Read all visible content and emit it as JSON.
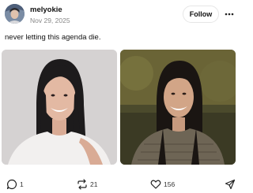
{
  "post": {
    "author": {
      "username": "melyokie",
      "date": "Nov 29, 2025"
    },
    "follow_label": "Follow",
    "text": "never letting this agenda die.",
    "images": [
      {
        "icon": "photo-woman-smiling-white-top"
      },
      {
        "icon": "photo-woman-smiling-knit-sweater"
      }
    ],
    "actions": {
      "reply_count": "1",
      "repost_count": "21",
      "like_count": "156"
    }
  },
  "colors": {
    "text": "#111111",
    "muted": "#888888",
    "button_border": "#e6e6e6"
  }
}
